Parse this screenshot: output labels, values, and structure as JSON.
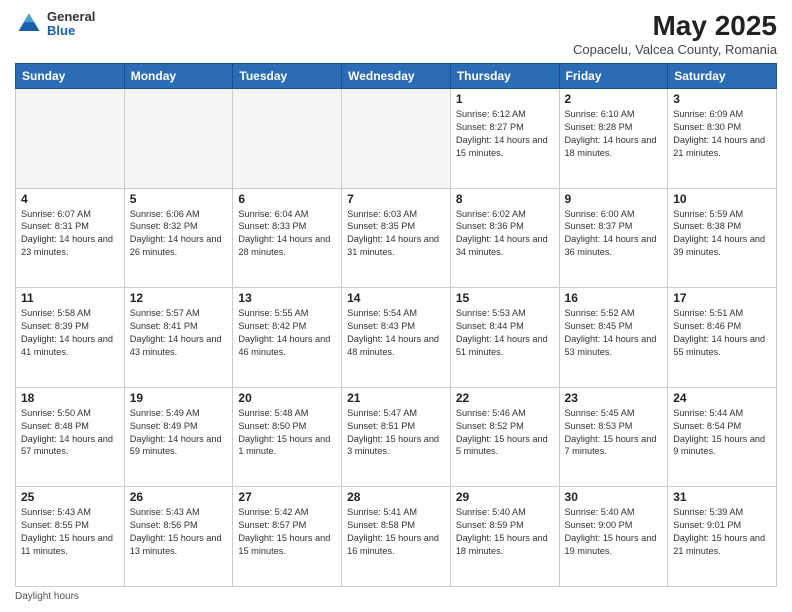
{
  "logo": {
    "general": "General",
    "blue": "Blue"
  },
  "header": {
    "title": "May 2025",
    "subtitle": "Copacelu, Valcea County, Romania"
  },
  "weekdays": [
    "Sunday",
    "Monday",
    "Tuesday",
    "Wednesday",
    "Thursday",
    "Friday",
    "Saturday"
  ],
  "weeks": [
    [
      {
        "day": "",
        "info": ""
      },
      {
        "day": "",
        "info": ""
      },
      {
        "day": "",
        "info": ""
      },
      {
        "day": "",
        "info": ""
      },
      {
        "day": "1",
        "info": "Sunrise: 6:12 AM\nSunset: 8:27 PM\nDaylight: 14 hours and 15 minutes."
      },
      {
        "day": "2",
        "info": "Sunrise: 6:10 AM\nSunset: 8:28 PM\nDaylight: 14 hours and 18 minutes."
      },
      {
        "day": "3",
        "info": "Sunrise: 6:09 AM\nSunset: 8:30 PM\nDaylight: 14 hours and 21 minutes."
      }
    ],
    [
      {
        "day": "4",
        "info": "Sunrise: 6:07 AM\nSunset: 8:31 PM\nDaylight: 14 hours and 23 minutes."
      },
      {
        "day": "5",
        "info": "Sunrise: 6:06 AM\nSunset: 8:32 PM\nDaylight: 14 hours and 26 minutes."
      },
      {
        "day": "6",
        "info": "Sunrise: 6:04 AM\nSunset: 8:33 PM\nDaylight: 14 hours and 28 minutes."
      },
      {
        "day": "7",
        "info": "Sunrise: 6:03 AM\nSunset: 8:35 PM\nDaylight: 14 hours and 31 minutes."
      },
      {
        "day": "8",
        "info": "Sunrise: 6:02 AM\nSunset: 8:36 PM\nDaylight: 14 hours and 34 minutes."
      },
      {
        "day": "9",
        "info": "Sunrise: 6:00 AM\nSunset: 8:37 PM\nDaylight: 14 hours and 36 minutes."
      },
      {
        "day": "10",
        "info": "Sunrise: 5:59 AM\nSunset: 8:38 PM\nDaylight: 14 hours and 39 minutes."
      }
    ],
    [
      {
        "day": "11",
        "info": "Sunrise: 5:58 AM\nSunset: 8:39 PM\nDaylight: 14 hours and 41 minutes."
      },
      {
        "day": "12",
        "info": "Sunrise: 5:57 AM\nSunset: 8:41 PM\nDaylight: 14 hours and 43 minutes."
      },
      {
        "day": "13",
        "info": "Sunrise: 5:55 AM\nSunset: 8:42 PM\nDaylight: 14 hours and 46 minutes."
      },
      {
        "day": "14",
        "info": "Sunrise: 5:54 AM\nSunset: 8:43 PM\nDaylight: 14 hours and 48 minutes."
      },
      {
        "day": "15",
        "info": "Sunrise: 5:53 AM\nSunset: 8:44 PM\nDaylight: 14 hours and 51 minutes."
      },
      {
        "day": "16",
        "info": "Sunrise: 5:52 AM\nSunset: 8:45 PM\nDaylight: 14 hours and 53 minutes."
      },
      {
        "day": "17",
        "info": "Sunrise: 5:51 AM\nSunset: 8:46 PM\nDaylight: 14 hours and 55 minutes."
      }
    ],
    [
      {
        "day": "18",
        "info": "Sunrise: 5:50 AM\nSunset: 8:48 PM\nDaylight: 14 hours and 57 minutes."
      },
      {
        "day": "19",
        "info": "Sunrise: 5:49 AM\nSunset: 8:49 PM\nDaylight: 14 hours and 59 minutes."
      },
      {
        "day": "20",
        "info": "Sunrise: 5:48 AM\nSunset: 8:50 PM\nDaylight: 15 hours and 1 minute."
      },
      {
        "day": "21",
        "info": "Sunrise: 5:47 AM\nSunset: 8:51 PM\nDaylight: 15 hours and 3 minutes."
      },
      {
        "day": "22",
        "info": "Sunrise: 5:46 AM\nSunset: 8:52 PM\nDaylight: 15 hours and 5 minutes."
      },
      {
        "day": "23",
        "info": "Sunrise: 5:45 AM\nSunset: 8:53 PM\nDaylight: 15 hours and 7 minutes."
      },
      {
        "day": "24",
        "info": "Sunrise: 5:44 AM\nSunset: 8:54 PM\nDaylight: 15 hours and 9 minutes."
      }
    ],
    [
      {
        "day": "25",
        "info": "Sunrise: 5:43 AM\nSunset: 8:55 PM\nDaylight: 15 hours and 11 minutes."
      },
      {
        "day": "26",
        "info": "Sunrise: 5:43 AM\nSunset: 8:56 PM\nDaylight: 15 hours and 13 minutes."
      },
      {
        "day": "27",
        "info": "Sunrise: 5:42 AM\nSunset: 8:57 PM\nDaylight: 15 hours and 15 minutes."
      },
      {
        "day": "28",
        "info": "Sunrise: 5:41 AM\nSunset: 8:58 PM\nDaylight: 15 hours and 16 minutes."
      },
      {
        "day": "29",
        "info": "Sunrise: 5:40 AM\nSunset: 8:59 PM\nDaylight: 15 hours and 18 minutes."
      },
      {
        "day": "30",
        "info": "Sunrise: 5:40 AM\nSunset: 9:00 PM\nDaylight: 15 hours and 19 minutes."
      },
      {
        "day": "31",
        "info": "Sunrise: 5:39 AM\nSunset: 9:01 PM\nDaylight: 15 hours and 21 minutes."
      }
    ]
  ],
  "footer": {
    "daylight_label": "Daylight hours"
  }
}
